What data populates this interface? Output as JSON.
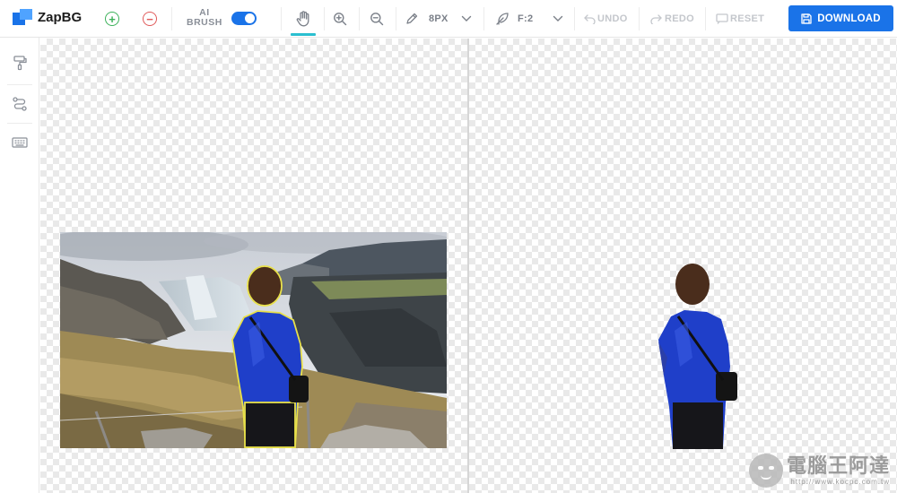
{
  "app": {
    "logo_text": "ZapBG"
  },
  "toolbar": {
    "add_icon": "plus-circle-icon",
    "remove_icon": "minus-circle-icon",
    "ai_brush_line1": "AI",
    "ai_brush_line2": "BRUSH",
    "ai_brush_enabled": true,
    "brush_size": "8PX",
    "feather": "F:2",
    "undo_label": "UNDO",
    "redo_label": "REDO",
    "reset_label": "RESET",
    "download_label": "DOWNLOAD"
  },
  "sidebar": {
    "items": [
      {
        "icon": "paint-roller-icon"
      },
      {
        "icon": "path-icon"
      },
      {
        "icon": "keyboard-icon"
      }
    ]
  },
  "colors": {
    "accent": "#1a73e8",
    "active_tool": "#2bbfd0",
    "add": "#3cb15a",
    "remove": "#e05a5a",
    "jacket": "#1f3fc9",
    "selection_outline": "#e8e04a"
  },
  "watermark": {
    "title": "電腦王阿達",
    "url": "http://www.kocpc.com.tw"
  }
}
